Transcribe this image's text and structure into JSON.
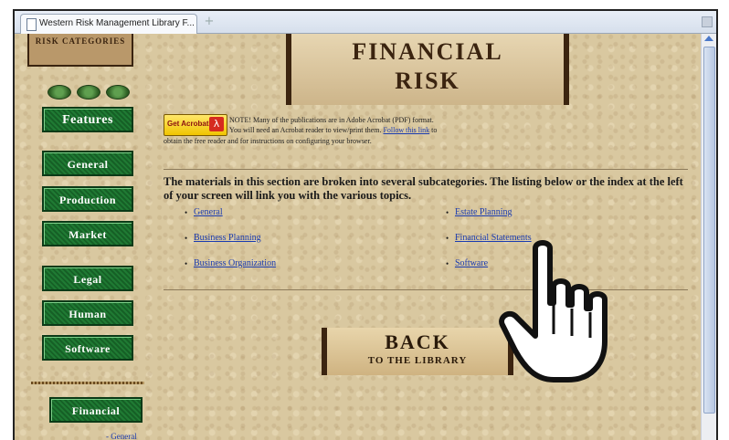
{
  "browser": {
    "tab_title": "Western Risk Management Library F...",
    "new_tab_glyph": "+"
  },
  "sidebar": {
    "risk_categories_label": "RISK CATEGORIES",
    "buttons": [
      {
        "label": "Features"
      },
      {
        "label": "General"
      },
      {
        "label": "Production"
      },
      {
        "label": "Market"
      },
      {
        "label": "Legal"
      },
      {
        "label": "Human"
      },
      {
        "label": "Software"
      },
      {
        "label": "Financial"
      }
    ],
    "sublink_general": "General"
  },
  "banner": {
    "line1": "FINANCIAL",
    "line2": "RISK"
  },
  "acrobat": {
    "button_label": "Get Acrobat",
    "logo_glyph": "λ",
    "note_line1": "NOTE! Many of the publications are in Adobe Acrobat (PDF) format.",
    "note_line2_pre": "You will need an Acrobat reader to view/print them.",
    "note_link": "Follow this link",
    "note_line2_post": "to",
    "note_line3": "obtain the free reader and for instructions on configuring your browser."
  },
  "intro_text": "The materials in this section are broken into several subcategories. The listing below or the index at the left of your screen will link you with the various topics.",
  "topics": {
    "left": [
      "General",
      "Business Planning",
      "Business Organization"
    ],
    "right": [
      "Estate Planning",
      "Financial Statements",
      "Software"
    ]
  },
  "back_button": {
    "line1": "BACK",
    "line2": "TO THE LIBRARY"
  }
}
